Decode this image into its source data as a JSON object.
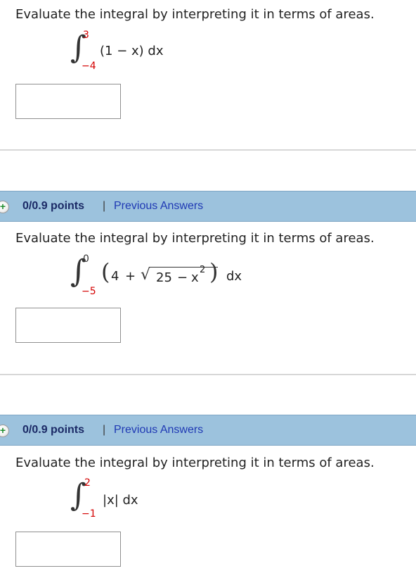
{
  "q1": {
    "prompt": "Evaluate the integral by interpreting it in terms of areas.",
    "upper": "3",
    "lower": "−4",
    "integrand": "(1 − x) dx"
  },
  "q2": {
    "points": "0/0.9 points",
    "separator": "|",
    "previous": "Previous Answers",
    "prompt": "Evaluate the integral by interpreting it in terms of areas.",
    "upper": "0",
    "lower": "−5",
    "open_paren": "(",
    "close_paren": ")",
    "term1": "4",
    "plus": "+",
    "radical": "√",
    "radicand_a": "25",
    "minus": "−",
    "radicand_x": "x",
    "radicand_exp": "2",
    "dx": "dx"
  },
  "q3": {
    "points": "0/0.9 points",
    "separator": "|",
    "previous": "Previous Answers",
    "prompt": "Evaluate the integral by interpreting it in terms of areas.",
    "upper": "2",
    "lower": "−1",
    "integrand": "|x| dx"
  },
  "colors": {
    "limit_red": "#d40000",
    "bar_blue": "#9cc2dd",
    "link_blue": "#1f39b4",
    "points_navy": "#1b2a66",
    "plus_green": "#1f8c2d"
  },
  "icons": [
    "plus-circle-icon"
  ]
}
